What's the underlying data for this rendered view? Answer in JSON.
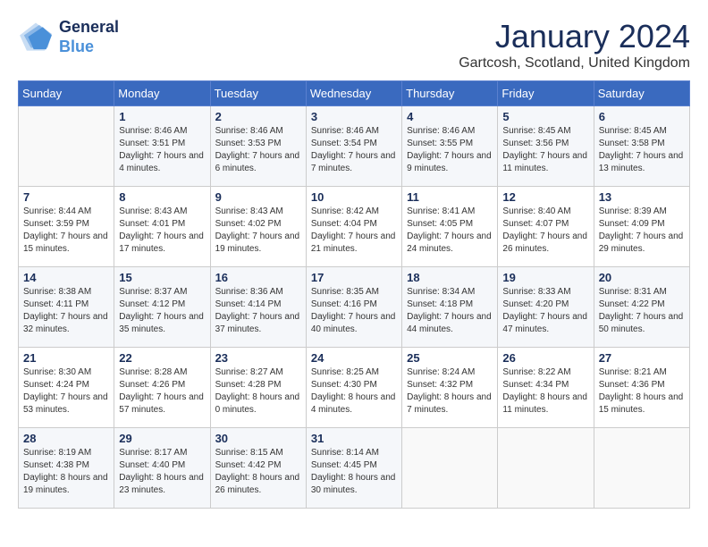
{
  "logo": {
    "line1": "General",
    "line2": "Blue"
  },
  "title": "January 2024",
  "location": "Gartcosh, Scotland, United Kingdom",
  "weekdays": [
    "Sunday",
    "Monday",
    "Tuesday",
    "Wednesday",
    "Thursday",
    "Friday",
    "Saturday"
  ],
  "weeks": [
    [
      {
        "day": "",
        "sunrise": "",
        "sunset": "",
        "daylight": ""
      },
      {
        "day": "1",
        "sunrise": "Sunrise: 8:46 AM",
        "sunset": "Sunset: 3:51 PM",
        "daylight": "Daylight: 7 hours and 4 minutes."
      },
      {
        "day": "2",
        "sunrise": "Sunrise: 8:46 AM",
        "sunset": "Sunset: 3:53 PM",
        "daylight": "Daylight: 7 hours and 6 minutes."
      },
      {
        "day": "3",
        "sunrise": "Sunrise: 8:46 AM",
        "sunset": "Sunset: 3:54 PM",
        "daylight": "Daylight: 7 hours and 7 minutes."
      },
      {
        "day": "4",
        "sunrise": "Sunrise: 8:46 AM",
        "sunset": "Sunset: 3:55 PM",
        "daylight": "Daylight: 7 hours and 9 minutes."
      },
      {
        "day": "5",
        "sunrise": "Sunrise: 8:45 AM",
        "sunset": "Sunset: 3:56 PM",
        "daylight": "Daylight: 7 hours and 11 minutes."
      },
      {
        "day": "6",
        "sunrise": "Sunrise: 8:45 AM",
        "sunset": "Sunset: 3:58 PM",
        "daylight": "Daylight: 7 hours and 13 minutes."
      }
    ],
    [
      {
        "day": "7",
        "sunrise": "Sunrise: 8:44 AM",
        "sunset": "Sunset: 3:59 PM",
        "daylight": "Daylight: 7 hours and 15 minutes."
      },
      {
        "day": "8",
        "sunrise": "Sunrise: 8:43 AM",
        "sunset": "Sunset: 4:01 PM",
        "daylight": "Daylight: 7 hours and 17 minutes."
      },
      {
        "day": "9",
        "sunrise": "Sunrise: 8:43 AM",
        "sunset": "Sunset: 4:02 PM",
        "daylight": "Daylight: 7 hours and 19 minutes."
      },
      {
        "day": "10",
        "sunrise": "Sunrise: 8:42 AM",
        "sunset": "Sunset: 4:04 PM",
        "daylight": "Daylight: 7 hours and 21 minutes."
      },
      {
        "day": "11",
        "sunrise": "Sunrise: 8:41 AM",
        "sunset": "Sunset: 4:05 PM",
        "daylight": "Daylight: 7 hours and 24 minutes."
      },
      {
        "day": "12",
        "sunrise": "Sunrise: 8:40 AM",
        "sunset": "Sunset: 4:07 PM",
        "daylight": "Daylight: 7 hours and 26 minutes."
      },
      {
        "day": "13",
        "sunrise": "Sunrise: 8:39 AM",
        "sunset": "Sunset: 4:09 PM",
        "daylight": "Daylight: 7 hours and 29 minutes."
      }
    ],
    [
      {
        "day": "14",
        "sunrise": "Sunrise: 8:38 AM",
        "sunset": "Sunset: 4:11 PM",
        "daylight": "Daylight: 7 hours and 32 minutes."
      },
      {
        "day": "15",
        "sunrise": "Sunrise: 8:37 AM",
        "sunset": "Sunset: 4:12 PM",
        "daylight": "Daylight: 7 hours and 35 minutes."
      },
      {
        "day": "16",
        "sunrise": "Sunrise: 8:36 AM",
        "sunset": "Sunset: 4:14 PM",
        "daylight": "Daylight: 7 hours and 37 minutes."
      },
      {
        "day": "17",
        "sunrise": "Sunrise: 8:35 AM",
        "sunset": "Sunset: 4:16 PM",
        "daylight": "Daylight: 7 hours and 40 minutes."
      },
      {
        "day": "18",
        "sunrise": "Sunrise: 8:34 AM",
        "sunset": "Sunset: 4:18 PM",
        "daylight": "Daylight: 7 hours and 44 minutes."
      },
      {
        "day": "19",
        "sunrise": "Sunrise: 8:33 AM",
        "sunset": "Sunset: 4:20 PM",
        "daylight": "Daylight: 7 hours and 47 minutes."
      },
      {
        "day": "20",
        "sunrise": "Sunrise: 8:31 AM",
        "sunset": "Sunset: 4:22 PM",
        "daylight": "Daylight: 7 hours and 50 minutes."
      }
    ],
    [
      {
        "day": "21",
        "sunrise": "Sunrise: 8:30 AM",
        "sunset": "Sunset: 4:24 PM",
        "daylight": "Daylight: 7 hours and 53 minutes."
      },
      {
        "day": "22",
        "sunrise": "Sunrise: 8:28 AM",
        "sunset": "Sunset: 4:26 PM",
        "daylight": "Daylight: 7 hours and 57 minutes."
      },
      {
        "day": "23",
        "sunrise": "Sunrise: 8:27 AM",
        "sunset": "Sunset: 4:28 PM",
        "daylight": "Daylight: 8 hours and 0 minutes."
      },
      {
        "day": "24",
        "sunrise": "Sunrise: 8:25 AM",
        "sunset": "Sunset: 4:30 PM",
        "daylight": "Daylight: 8 hours and 4 minutes."
      },
      {
        "day": "25",
        "sunrise": "Sunrise: 8:24 AM",
        "sunset": "Sunset: 4:32 PM",
        "daylight": "Daylight: 8 hours and 7 minutes."
      },
      {
        "day": "26",
        "sunrise": "Sunrise: 8:22 AM",
        "sunset": "Sunset: 4:34 PM",
        "daylight": "Daylight: 8 hours and 11 minutes."
      },
      {
        "day": "27",
        "sunrise": "Sunrise: 8:21 AM",
        "sunset": "Sunset: 4:36 PM",
        "daylight": "Daylight: 8 hours and 15 minutes."
      }
    ],
    [
      {
        "day": "28",
        "sunrise": "Sunrise: 8:19 AM",
        "sunset": "Sunset: 4:38 PM",
        "daylight": "Daylight: 8 hours and 19 minutes."
      },
      {
        "day": "29",
        "sunrise": "Sunrise: 8:17 AM",
        "sunset": "Sunset: 4:40 PM",
        "daylight": "Daylight: 8 hours and 23 minutes."
      },
      {
        "day": "30",
        "sunrise": "Sunrise: 8:15 AM",
        "sunset": "Sunset: 4:42 PM",
        "daylight": "Daylight: 8 hours and 26 minutes."
      },
      {
        "day": "31",
        "sunrise": "Sunrise: 8:14 AM",
        "sunset": "Sunset: 4:45 PM",
        "daylight": "Daylight: 8 hours and 30 minutes."
      },
      {
        "day": "",
        "sunrise": "",
        "sunset": "",
        "daylight": ""
      },
      {
        "day": "",
        "sunrise": "",
        "sunset": "",
        "daylight": ""
      },
      {
        "day": "",
        "sunrise": "",
        "sunset": "",
        "daylight": ""
      }
    ]
  ]
}
